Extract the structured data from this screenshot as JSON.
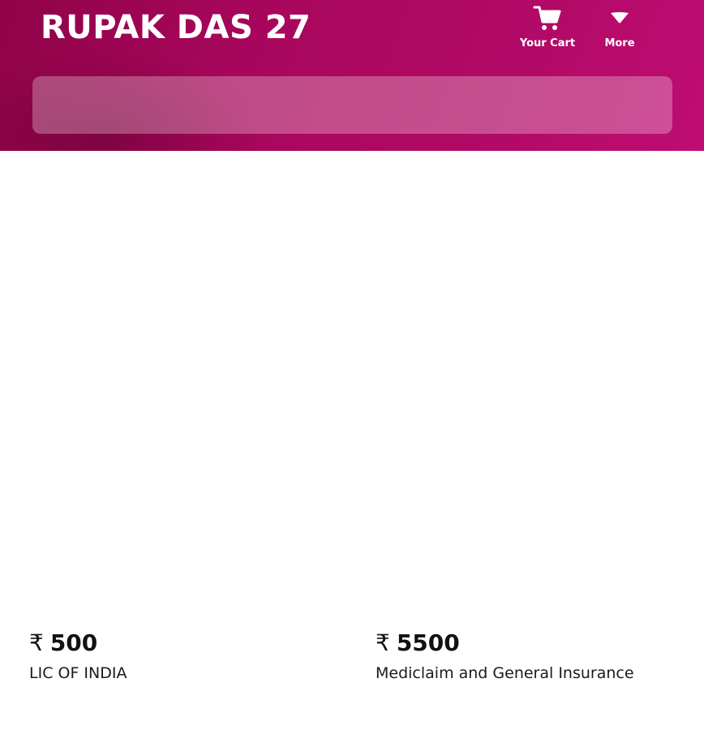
{
  "header": {
    "title": "RUPAK DAS 27",
    "actions": [
      {
        "icon": "cart-icon",
        "label": "Your Cart"
      },
      {
        "icon": "chevron-down-icon",
        "label": "More"
      }
    ],
    "search": {
      "placeholder": ""
    }
  },
  "products": [
    {
      "currency": "₹",
      "price": "500",
      "name": "LIC OF INDIA"
    },
    {
      "currency": "₹",
      "price": "5500",
      "name": "Mediclaim and General Insurance"
    }
  ],
  "colors": {
    "header_primary": "#a8065c",
    "header_accent": "#be0d73",
    "text_on_header": "#ffffff",
    "body_text": "#111111"
  }
}
